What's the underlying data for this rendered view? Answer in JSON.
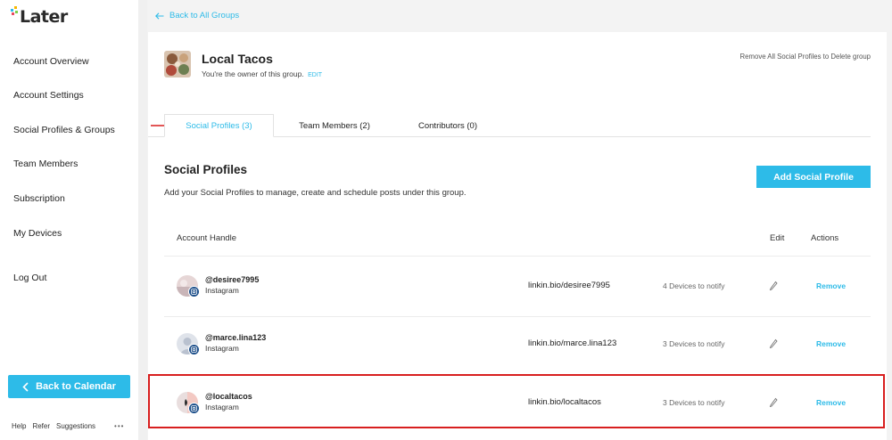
{
  "app": {
    "logo_text": "Later",
    "brand_color": "#2dbbe8"
  },
  "sidebar": {
    "items": [
      {
        "label": "Account Overview"
      },
      {
        "label": "Account Settings"
      },
      {
        "label": "Social Profiles & Groups"
      },
      {
        "label": "Team Members"
      },
      {
        "label": "Subscription"
      },
      {
        "label": "My Devices"
      },
      {
        "label": "Log Out"
      }
    ],
    "back_to_calendar": "Back to Calendar",
    "footer": {
      "help": "Help",
      "refer": "Refer",
      "suggestions": "Suggestions",
      "more": "•••"
    }
  },
  "header": {
    "back_link": "Back to All Groups"
  },
  "group": {
    "name": "Local Tacos",
    "owner_text": "You're the owner of this group.",
    "edit_label": "EDIT",
    "remove_all": "Remove All Social Profiles to Delete group"
  },
  "tabs": [
    {
      "label": "Social Profiles (3)",
      "active": true
    },
    {
      "label": "Team Members (2)",
      "active": false
    },
    {
      "label": "Contributors (0)",
      "active": false
    }
  ],
  "section": {
    "title": "Social Profiles",
    "description": "Add your Social Profiles to manage, create and schedule posts under this group.",
    "add_button": "Add Social Profile"
  },
  "table": {
    "columns": {
      "handle": "Account Handle",
      "edit": "Edit",
      "actions": "Actions"
    },
    "rows": [
      {
        "handle": "@desiree7995",
        "platform": "Instagram",
        "link": "linkin.bio/desiree7995",
        "devices": "4 Devices to notify",
        "remove": "Remove"
      },
      {
        "handle": "@marce.lina123",
        "platform": "Instagram",
        "link": "linkin.bio/marce.lina123",
        "devices": "3 Devices to notify",
        "remove": "Remove"
      },
      {
        "handle": "@localtacos",
        "platform": "Instagram",
        "link": "linkin.bio/localtacos",
        "devices": "3 Devices to notify",
        "remove": "Remove"
      }
    ]
  }
}
